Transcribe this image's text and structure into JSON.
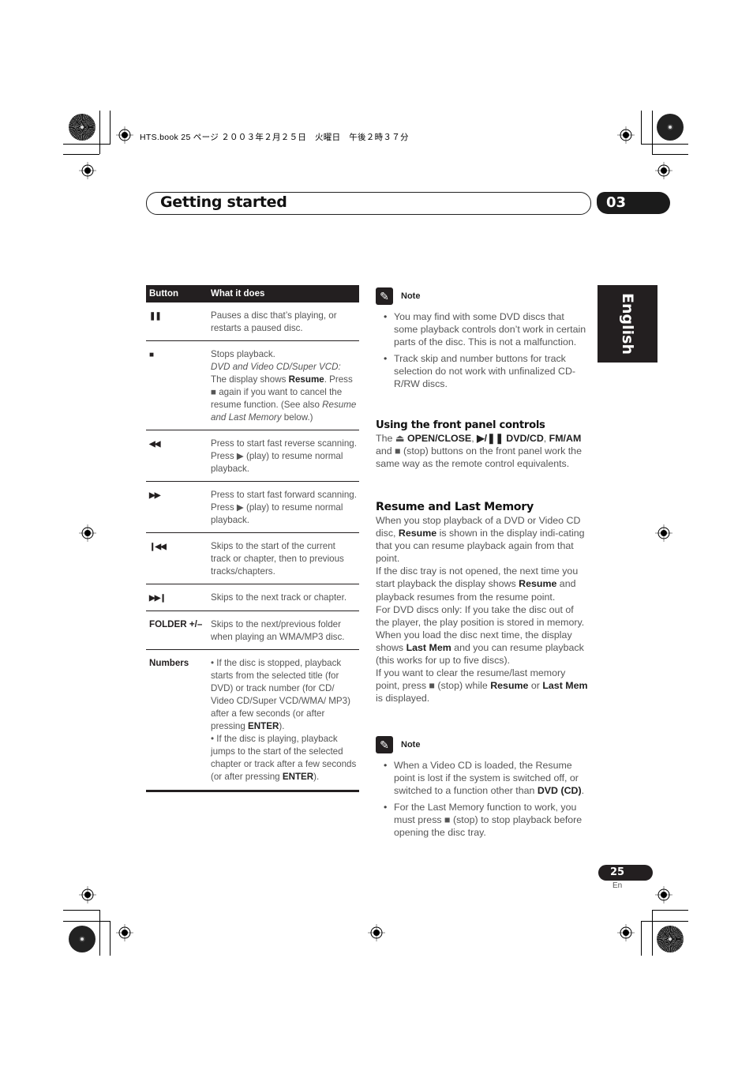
{
  "slug": "HTS.book  25 ページ  ２００３年２月２５日　火曜日　午後２時３７分",
  "header": {
    "title": "Getting started",
    "chapter": "03"
  },
  "language_tab": "English",
  "table": {
    "headers": [
      "Button",
      "What it does"
    ],
    "rows": [
      {
        "button_icon": "pause-icon",
        "button": "❚❚",
        "desc_html": "Pauses a disc that’s playing, or restarts a paused disc."
      },
      {
        "button_icon": "stop-icon",
        "button": "■",
        "desc_html": "Stops playback.<br><i>DVD and Video CD/Super VCD:</i><br>The display shows <b>Resume</b>. Press ■ again if you want to cancel the resume function. (See also <i>Resume and Last Memory</i> below.)"
      },
      {
        "button_icon": "fast-reverse-icon",
        "button": "◀◀",
        "desc_html": "Press to start fast reverse scanning. Press ▶ (play) to resume normal playback."
      },
      {
        "button_icon": "fast-forward-icon",
        "button": "▶▶",
        "desc_html": "Press to start fast forward scanning. Press ▶ (play) to resume normal playback."
      },
      {
        "button_icon": "skip-previous-icon",
        "button": "❙◀◀",
        "desc_html": "Skips to the start of the current track or chapter, then to previous tracks/chapters."
      },
      {
        "button_icon": "skip-next-icon",
        "button": "▶▶❙",
        "desc_html": "Skips to the next track or chapter."
      },
      {
        "button_icon": "",
        "button": "FOLDER +/–",
        "desc_html": "Skips to the next/previous folder when playing an WMA/MP3 disc."
      },
      {
        "button_icon": "",
        "button": "Numbers",
        "desc_html": "• If the disc is stopped, playback starts from the selected title (for DVD) or track number (for CD/ Video CD/Super VCD/WMA/ MP3) after a few seconds (or after pressing <b>ENTER</b>).<br>• If the disc is playing, playback jumps to the start of the selected chapter or track after a few seconds (or after pressing <b>ENTER</b>)."
      }
    ]
  },
  "note1": {
    "label": "Note",
    "items": [
      "You may find with some DVD discs that some playback controls don’t work in certain parts of the disc. This is not a malfunction.",
      "Track skip and number buttons for track selection do not work with unfinalized CD-R/RW discs."
    ]
  },
  "front_panel": {
    "title": "Using the front panel controls",
    "body_html": "The ⏏ <b>OPEN/CLOSE</b>, <b>▶/❚❚ DVD/CD</b>, <b>FM/AM</b> and ■ (stop) buttons on the front panel work the same way as the remote control equivalents."
  },
  "resume": {
    "title": "Resume and Last Memory",
    "paragraphs_html": [
      "When you stop playback of a DVD or Video CD disc, <b>Resume</b> is shown in the display indi-cating that you can resume playback again from that point.",
      "If the disc tray is not opened, the next time you start playback the display shows <b>Resume</b> and playback resumes from the resume point.",
      "For DVD discs only: If you take the disc out of the player, the play position is stored in memory. When you load the disc next time, the display shows <b>Last Mem</b> and you can resume playback (this works for up to five discs).",
      "If you want to clear the resume/last memory point, press ■ (stop) while <b>Resume</b> or <b>Last Mem</b> is displayed."
    ]
  },
  "note2": {
    "label": "Note",
    "items_html": [
      "When a Video CD is loaded, the Resume point is lost if the system is switched off, or switched to a function other than <b>DVD (CD)</b>.",
      "For the Last Memory function to work, you must press ■ (stop) to stop playback before opening the disc tray."
    ]
  },
  "footer": {
    "page": "25",
    "lang": "En"
  }
}
